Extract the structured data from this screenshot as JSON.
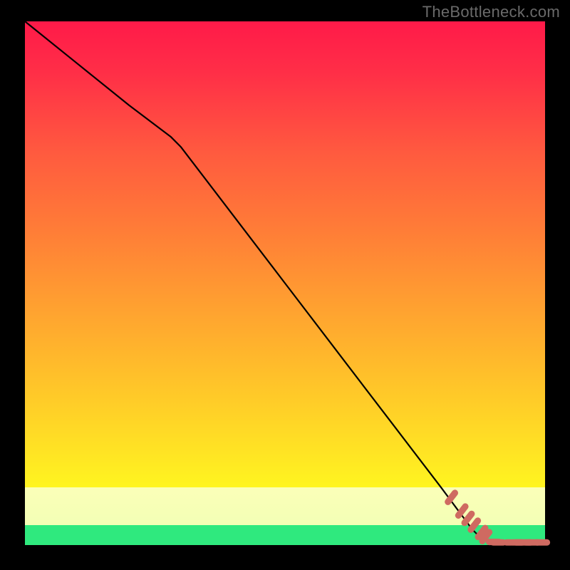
{
  "branding": {
    "watermark": "TheBottleneck.com"
  },
  "chart_data": {
    "type": "line",
    "title": "",
    "xlabel": "",
    "ylabel": "",
    "xlim": [
      0,
      100
    ],
    "ylim": [
      0,
      100
    ],
    "grid": false,
    "series": [
      {
        "name": "curve",
        "x": [
          0,
          10,
          20,
          28,
          30,
          40,
          50,
          60,
          70,
          80,
          86,
          88,
          90,
          92,
          94,
          96,
          98,
          100
        ],
        "y": [
          100,
          92,
          84,
          78,
          76,
          63,
          50,
          37,
          24,
          11,
          3,
          1,
          0.5,
          0.4,
          0.4,
          0.3,
          0.3,
          0.3
        ]
      }
    ],
    "markers": {
      "name": "bottom-dash-dots",
      "x": [
        82,
        84,
        85.2,
        86.4,
        87.8,
        88.6,
        90.2,
        91.0,
        93.0,
        94.6,
        95.4,
        96.8,
        97.6,
        99.4
      ],
      "y": [
        9.1,
        6.5,
        5.1,
        3.8,
        2.4,
        1.6,
        0.6,
        0.5,
        0.5,
        0.5,
        0.5,
        0.5,
        0.5,
        0.5
      ],
      "style": "rounded-dash",
      "color": "#cf6a61"
    },
    "colors": {
      "gradient_top": "#ff1a49",
      "gradient_mid": "#ffc629",
      "gradient_bottom": "#fff81f",
      "pale_band": "#fbffb8",
      "green_band": "#2fe97e",
      "line": "#000000",
      "marker": "#cf6a61",
      "background_frame": "#000000"
    }
  }
}
